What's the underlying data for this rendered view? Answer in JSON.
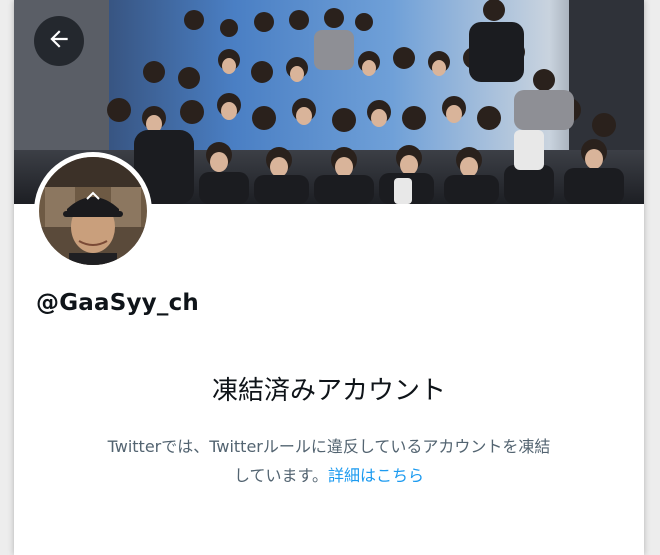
{
  "profile": {
    "handle": "@GaaSyy_ch",
    "avatar_alt": "profile-photo"
  },
  "suspension": {
    "title": "凍結済みアカウント",
    "message_line1": "Twitterでは、Twitterルールに違反しているアカウントを凍結",
    "message_line2": "しています。",
    "link_text": "詳細はこちら"
  },
  "colors": {
    "link": "#1d9bf0",
    "text_primary": "#0f1419",
    "text_secondary": "#536471"
  },
  "icons": {
    "back": "arrow-left-icon"
  }
}
